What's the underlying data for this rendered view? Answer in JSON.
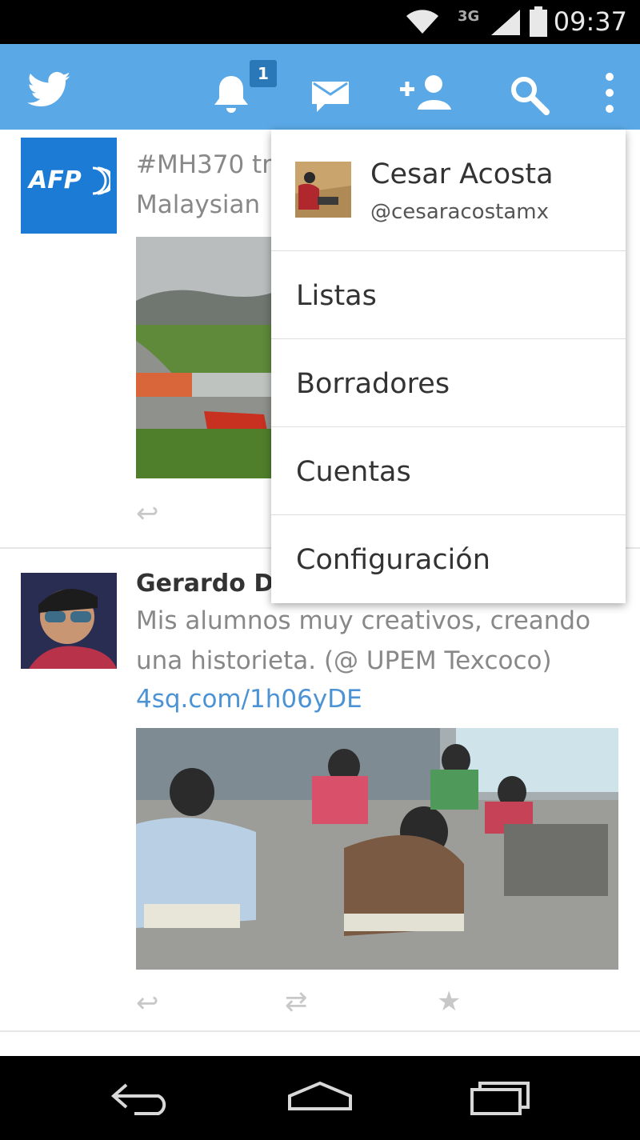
{
  "status_bar": {
    "network": "3G",
    "time": "09:37",
    "icons": [
      "wifi-icon",
      "signal-icon",
      "battery-icon"
    ]
  },
  "app_bar": {
    "notification_count": "1",
    "icons": [
      "twitter-bird-icon",
      "bell-icon",
      "mail-icon",
      "add-user-icon",
      "search-icon",
      "overflow-menu-icon"
    ]
  },
  "tweets": [
    {
      "author_partial": "",
      "avatar_text": "AFP",
      "lines": [
        "#MH370 tr",
        "Malaysian"
      ],
      "actions": [
        "reply-icon"
      ]
    },
    {
      "author": "Gerardo Do",
      "lines": [
        "Mis alumnos muy creativos, creando",
        "una historieta. (@ UPEM Texcoco)"
      ],
      "link": "4sq.com/1h06yDE",
      "actions": [
        "reply-icon",
        "retweet-icon",
        "favorite-icon"
      ]
    }
  ],
  "menu": {
    "profile": {
      "name": "Cesar Acosta",
      "handle": "@cesaracostamx"
    },
    "items": [
      "Listas",
      "Borradores",
      "Cuentas",
      "Configuración"
    ]
  },
  "colors": {
    "brand": "#5aa9e6",
    "link": "#4b93d4",
    "afp_blue": "#1c7bd4"
  }
}
